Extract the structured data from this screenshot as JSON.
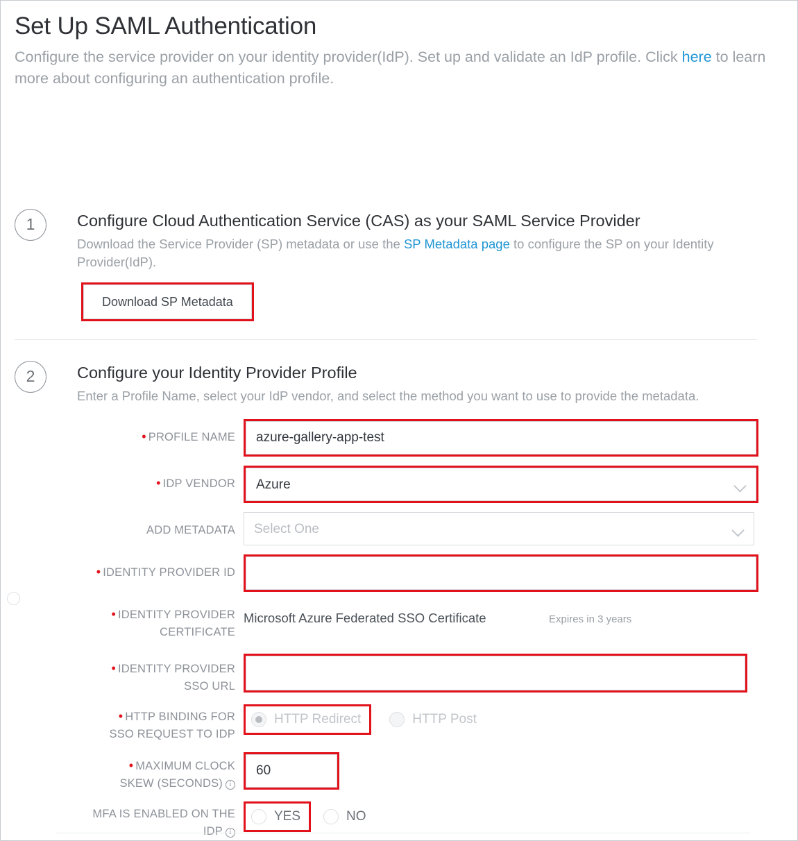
{
  "header": {
    "title": "Set Up SAML Authentication",
    "subtitle_part1": "Configure the service provider on your identity provider(IdP). Set up and validate an IdP profile. Click ",
    "subtitle_link": "here",
    "subtitle_part2": " to learn more about configuring an authentication profile."
  },
  "steps": [
    {
      "number": "1",
      "title": "Configure Cloud Authentication Service (CAS) as your SAML Service Provider",
      "desc_part1": "Download the Service Provider (SP) metadata or use the ",
      "desc_link": "SP Metadata page",
      "desc_part2": " to configure the SP on your Identity Provider(IdP).",
      "button_label": "Download SP Metadata"
    },
    {
      "number": "2",
      "title": "Configure your Identity Provider Profile",
      "desc": "Enter a Profile Name, select your IdP vendor, and select the method you want to use to provide the metadata."
    }
  ],
  "form": {
    "profile_name": {
      "label": "PROFILE NAME",
      "value": "azure-gallery-app-test",
      "placeholder": ""
    },
    "idp_vendor": {
      "label": "IDP VENDOR",
      "value": "Azure"
    },
    "add_metadata": {
      "label": "ADD METADATA",
      "value": "Select One"
    },
    "identity_provider_id": {
      "label": "IDENTITY PROVIDER ID",
      "value": "",
      "placeholder": ""
    },
    "identity_provider_certificate": {
      "label_line1": "IDENTITY PROVIDER",
      "label_line2": "CERTIFICATE",
      "value": "Microsoft Azure Federated SSO Certificate",
      "expiry": "Expires in 3 years"
    },
    "identity_provider_sso_url": {
      "label_line1": "IDENTITY PROVIDER",
      "label_line2": "SSO URL",
      "value": "",
      "placeholder": ""
    },
    "http_binding": {
      "label_line1": "HTTP BINDING FOR",
      "label_line2": "SSO REQUEST TO IDP",
      "option_redirect": "HTTP Redirect",
      "option_post": "HTTP Post",
      "selected": "HTTP Redirect"
    },
    "max_clock_skew": {
      "label_line1": "MAXIMUM CLOCK",
      "label_line2": "SKEW (SECONDS)",
      "value": "60"
    },
    "mfa_enabled": {
      "label_line1": "MFA IS ENABLED ON THE",
      "label_line2": "IDP",
      "option_yes": "YES",
      "option_no": "NO",
      "selected": ""
    }
  },
  "colors": {
    "highlight_red": "#e2121d",
    "link_blue": "#2196d4",
    "required_dot": "#e2121d",
    "label_gray": "#8d9299"
  }
}
